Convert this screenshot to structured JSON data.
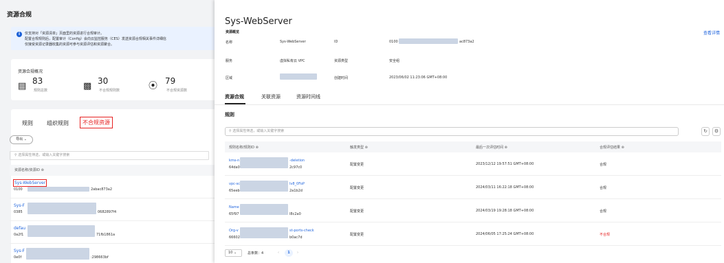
{
  "left": {
    "page_title": "资源合规",
    "notice": {
      "icon": "i",
      "line1": "仅支持对「资源清单」页面里的资源进行合规审计。",
      "line2": "配置合规规则后，配置审计（Config）会向云监控服务（CES）发送资源合规相关事件详细信",
      "line3": "仅接受资源记录器收集的资源可参与资源评估和资源聚合。"
    },
    "overview_title": "资源合规概况",
    "stats": [
      {
        "value": "83",
        "label": "规则总数"
      },
      {
        "value": "30",
        "label": "不合规规则数"
      },
      {
        "value": "79",
        "label": "不合规资源数"
      }
    ],
    "tabs": [
      "规则",
      "组织规则",
      "不合规资源"
    ],
    "export_label": "导出",
    "search_placeholder": "选择属性筛选，或输入关键字搜索",
    "column_header": "资源名称/资源ID ⊜",
    "rows": [
      {
        "name": "Sys-WebServer",
        "id_a": "0100",
        "id_b": "2abac873a2"
      },
      {
        "name": "Sys-F",
        "id_a": "0385",
        "id_b": "0682897f4"
      },
      {
        "name": "defau",
        "id_a": "0a2f1",
        "id_b": "71fb1861a"
      },
      {
        "name": "Sys-F",
        "id_a": "0e0f",
        "id_b": ":298663bf"
      }
    ]
  },
  "panel": {
    "title": "Sys-WebServer",
    "section": "资源概览",
    "view_details": "查看详情",
    "fields": {
      "name_label": "名称",
      "name_value": "Sys-WebServer",
      "id_label": "ID",
      "id_value_a": "0100",
      "id_value_b": "ac873a2",
      "service_label": "服务",
      "service_value": "虚拟私有云 VPC",
      "type_label": "资源类型",
      "type_value": "安全组",
      "region_label": "区域",
      "created_label": "创建时间",
      "created_value": "2023/06/02 11:23:06 GMT+08:00"
    },
    "tabs": [
      "资源合规",
      "关联资源",
      "资源时间线"
    ],
    "rules_title": "规则",
    "search_placeholder": "选择属性筛选，或输入关键字搜索",
    "columns": [
      "规则名称/规则ID ⊜",
      "触发类型 ⊜",
      "最后一次评估时间 ⊜",
      "合规评估结果 ⊜"
    ],
    "rows": [
      {
        "name_a": "kms-n",
        "name_b": "-deletion",
        "id_a": "64da0",
        "id_b": "2c97c0",
        "trigger": "配置变更",
        "time": "2023/12/12 19:57:51 GMT+08:00",
        "result": "合规"
      },
      {
        "name_a": "vpc-sc",
        "name_b": "lv8_0FoP",
        "id_a": "65eeb",
        "id_b": "2a1b2d",
        "trigger": "配置变更",
        "time": "2024/03/11 16:22:18 GMT+08:00",
        "result": "合规"
      },
      {
        "name_a": "Name",
        "name_b": "",
        "id_a": "65f97",
        "id_b": "l8c2a0",
        "trigger": "配置变更",
        "time": "2024/03/19 19:28:18 GMT+08:00",
        "result": "合规"
      },
      {
        "name_a": "Org-v",
        "name_b": "st-ports-check",
        "id_a": "66602",
        "id_b": "b0ac7d",
        "trigger": "配置变更",
        "time": "2024/06/05 17:25:24 GMT+08:00",
        "result": "不合规"
      }
    ],
    "pager": {
      "page_size": "10",
      "total": "总条数：4",
      "prev": "‹",
      "current": "1",
      "next": "›"
    }
  },
  "colors": {
    "accent": "#2266dd",
    "alert": "#e62020"
  }
}
